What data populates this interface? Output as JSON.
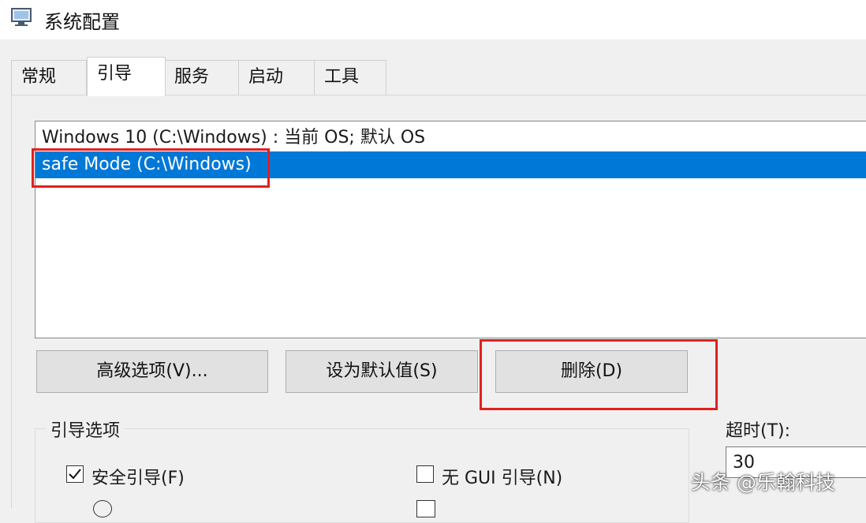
{
  "window": {
    "title": "系统配置",
    "icon": "system-config-icon"
  },
  "tabs": [
    {
      "label": "常规",
      "active": false
    },
    {
      "label": "引导",
      "active": true
    },
    {
      "label": "服务",
      "active": false
    },
    {
      "label": "启动",
      "active": false
    },
    {
      "label": "工具",
      "active": false
    }
  ],
  "boot_list": [
    {
      "label": "Windows 10 (C:\\Windows) : 当前 OS; 默认 OS",
      "selected": false
    },
    {
      "label": "safe Mode (C:\\Windows)",
      "selected": true
    }
  ],
  "buttons": {
    "advanced": "高级选项(V)...",
    "set_default": "设为默认值(S)",
    "delete": "删除(D)"
  },
  "boot_options": {
    "legend": "引导选项",
    "safe_boot": {
      "label": "安全引导(F)",
      "checked": true
    },
    "no_gui": {
      "label": "无 GUI 引导(N)",
      "checked": false
    }
  },
  "timeout": {
    "label": "超时(T):",
    "value": "30"
  },
  "watermark": "头条 @乐翰科技",
  "colors": {
    "selection": "#0078d7",
    "highlight_box": "#e02020"
  }
}
